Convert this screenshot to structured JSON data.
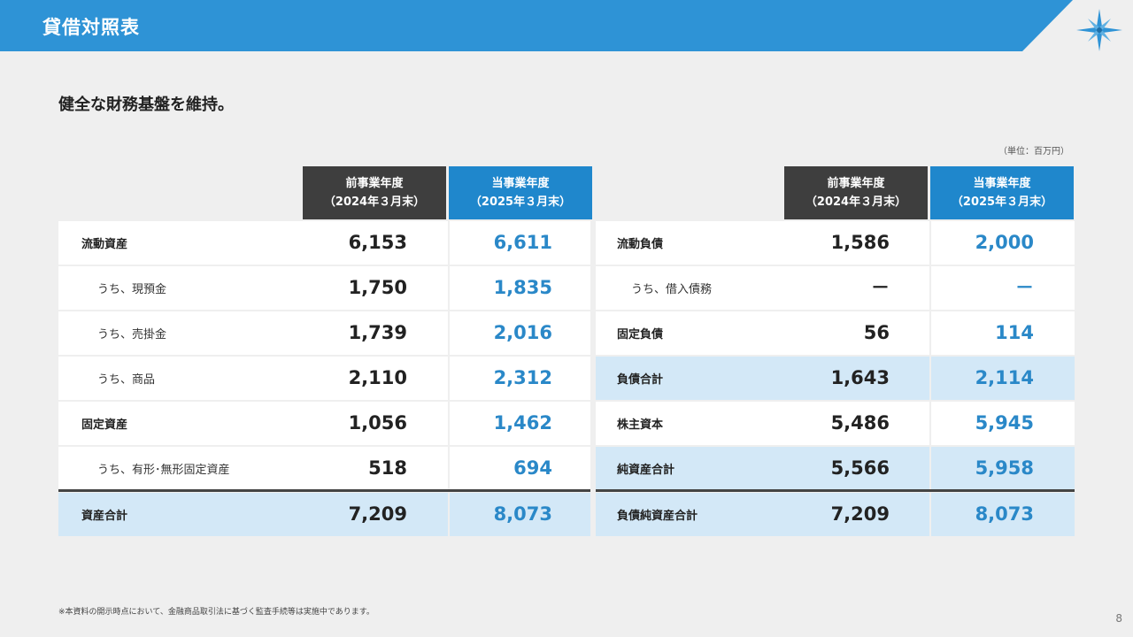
{
  "header": {
    "title": "貸借対照表"
  },
  "subtitle": "健全な財務基盤を維持。",
  "unit_note": "（単位：百万円）",
  "columns": {
    "prev_line1": "前事業年度",
    "prev_line2": "（2024年３月末）",
    "curr_line1": "当事業年度",
    "curr_line2": "（2025年３月末）"
  },
  "assets": [
    {
      "label": "流動資産",
      "prev": "6,153",
      "curr": "6,611"
    },
    {
      "label": "うち、現預金",
      "prev": "1,750",
      "curr": "1,835"
    },
    {
      "label": "うち、売掛金",
      "prev": "1,739",
      "curr": "2,016"
    },
    {
      "label": "うち、商品",
      "prev": "2,110",
      "curr": "2,312"
    },
    {
      "label": "固定資産",
      "prev": "1,056",
      "curr": "1,462"
    },
    {
      "label": "うち、有形･無形固定資産",
      "prev": "518",
      "curr": "694"
    },
    {
      "label": "資産合計",
      "prev": "7,209",
      "curr": "8,073"
    }
  ],
  "liabilities": [
    {
      "label": "流動負債",
      "prev": "1,586",
      "curr": "2,000"
    },
    {
      "label": "うち、借入債務",
      "prev": "－",
      "curr": "－"
    },
    {
      "label": "固定負債",
      "prev": "56",
      "curr": "114"
    },
    {
      "label": "負債合計",
      "prev": "1,643",
      "curr": "2,114"
    },
    {
      "label": "株主資本",
      "prev": "5,486",
      "curr": "5,945"
    },
    {
      "label": "純資産合計",
      "prev": "5,566",
      "curr": "5,958"
    },
    {
      "label": "負債純資産合計",
      "prev": "7,209",
      "curr": "8,073"
    }
  ],
  "footnote": "※本資料の開示時点において、金融商品取引法に基づく監査手続等は実施中であります。",
  "page_number": "8",
  "colors": {
    "brand_blue": "#2e93d6",
    "dark_header": "#3e3e3e",
    "value_blue": "#2a88c8",
    "highlight_row": "#d3e8f7"
  },
  "logo_icon": "compass-star-icon"
}
